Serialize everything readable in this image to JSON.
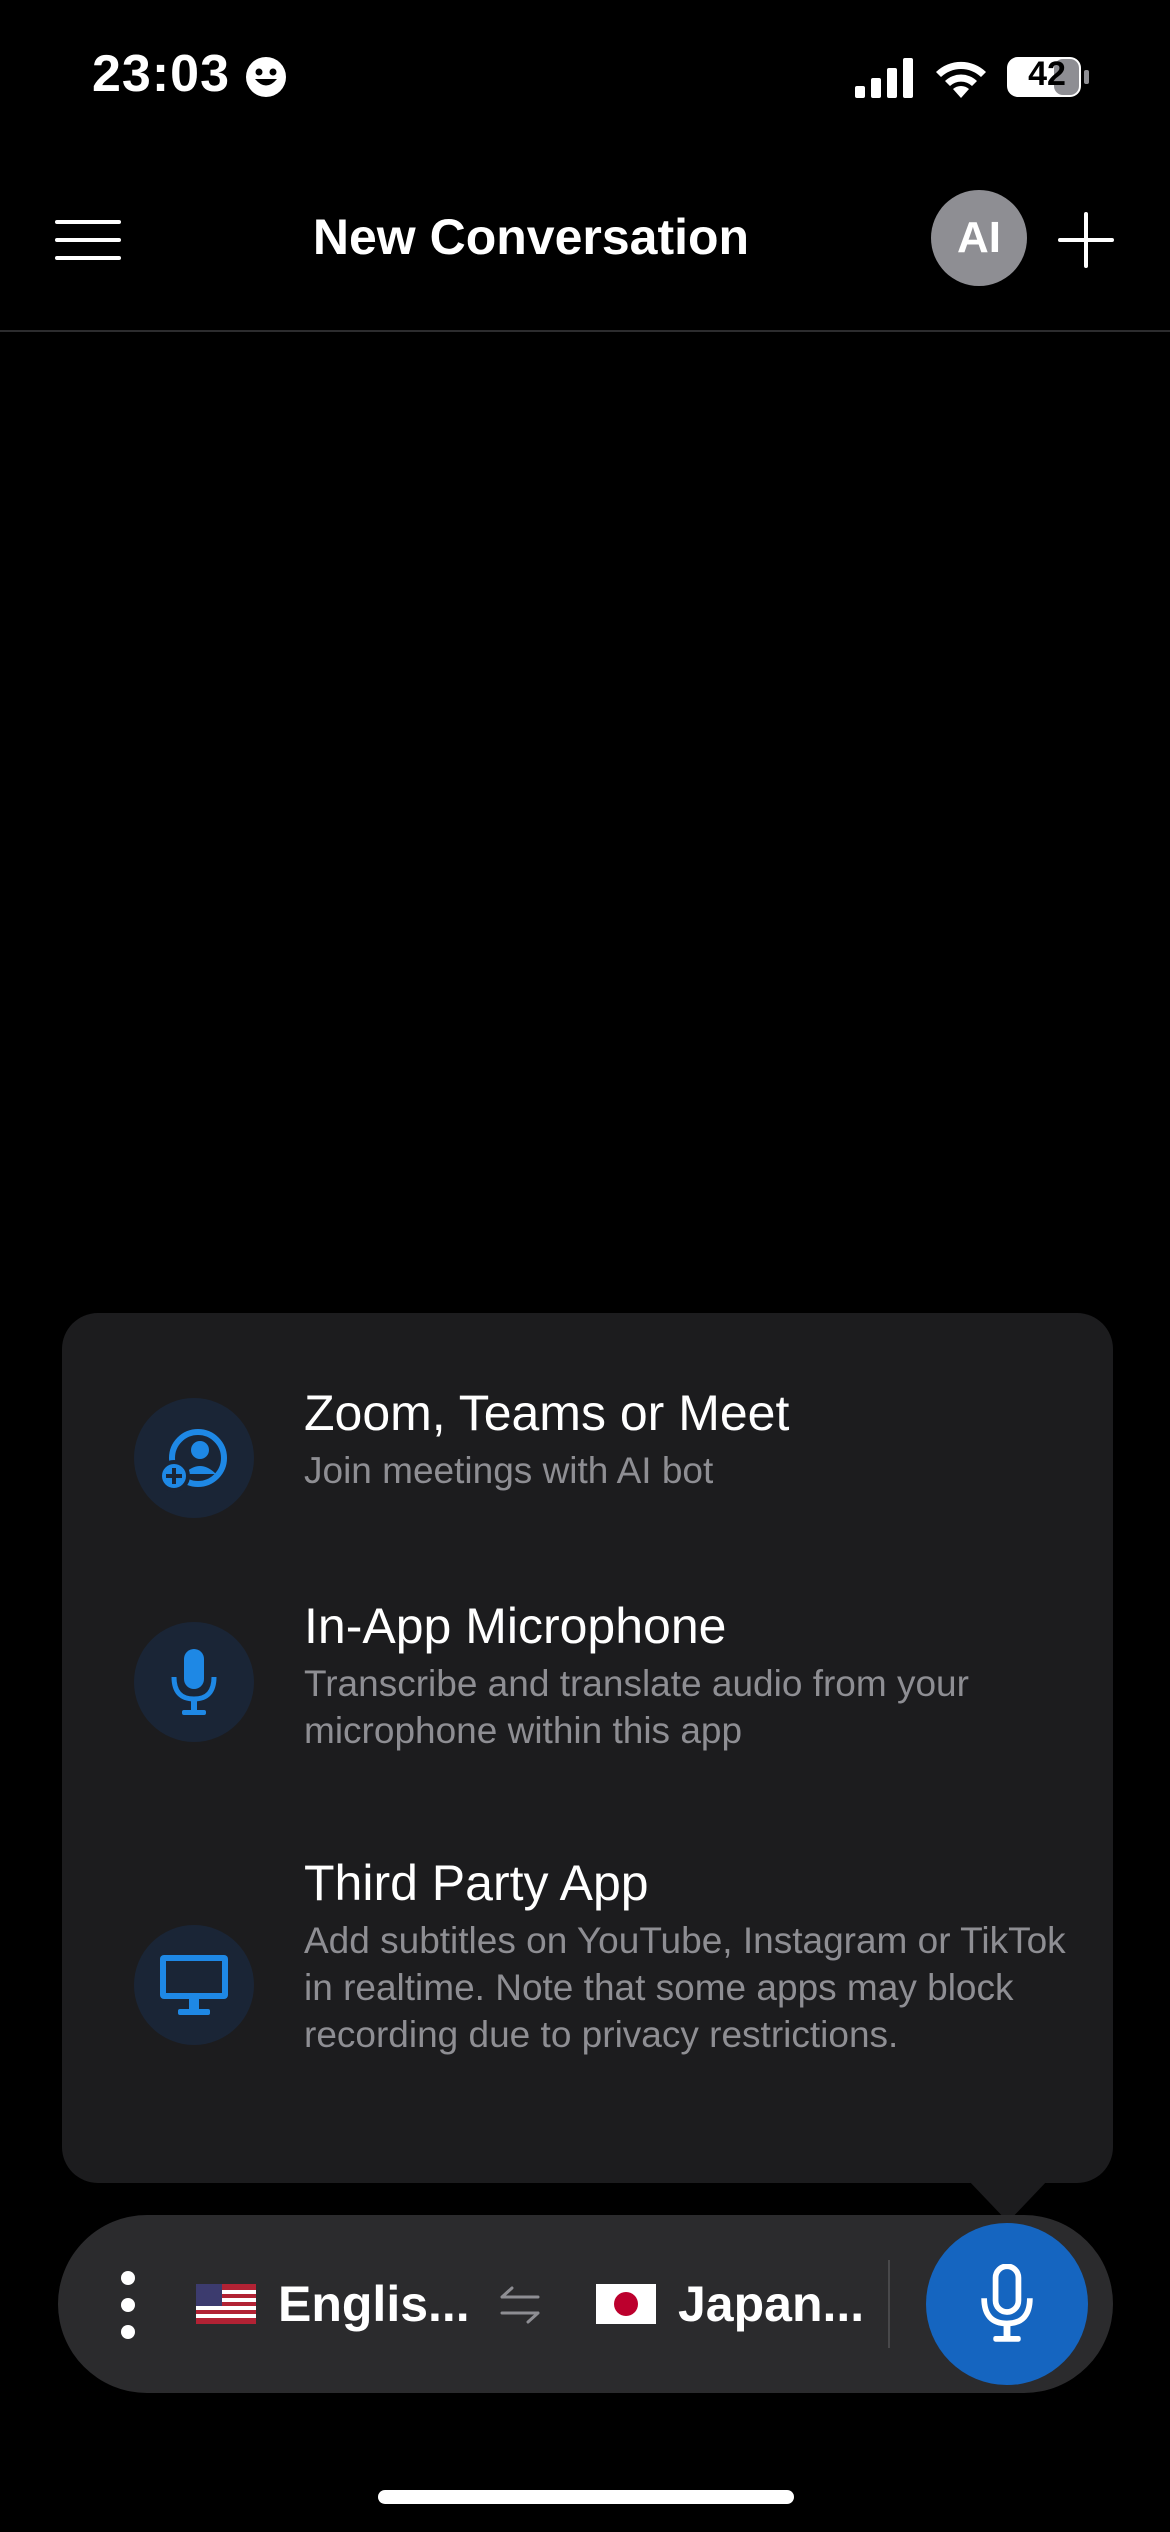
{
  "status_bar": {
    "time": "23:03",
    "battery": "42"
  },
  "header": {
    "title": "New Conversation",
    "avatar_label": "AI"
  },
  "popup": {
    "options": [
      {
        "title": "Zoom, Teams or Meet",
        "description": "Join meetings with AI bot",
        "icon": "user-add-icon"
      },
      {
        "title": "In-App Microphone",
        "description": "Transcribe and translate audio from your microphone within this app",
        "icon": "microphone-icon"
      },
      {
        "title": "Third Party App",
        "description": "Add subtitles on YouTube, Instagram or TikTok in realtime. Note that some apps may block recording due to privacy restrictions.",
        "icon": "monitor-icon"
      }
    ]
  },
  "bottom_bar": {
    "source_language": "Englis...",
    "target_language": "Japan...",
    "source_flag": "us-flag",
    "target_flag": "japan-flag"
  },
  "colors": {
    "accent": "#1565c0",
    "icon_blue": "#1e88e5",
    "panel": "#1c1c1e"
  }
}
